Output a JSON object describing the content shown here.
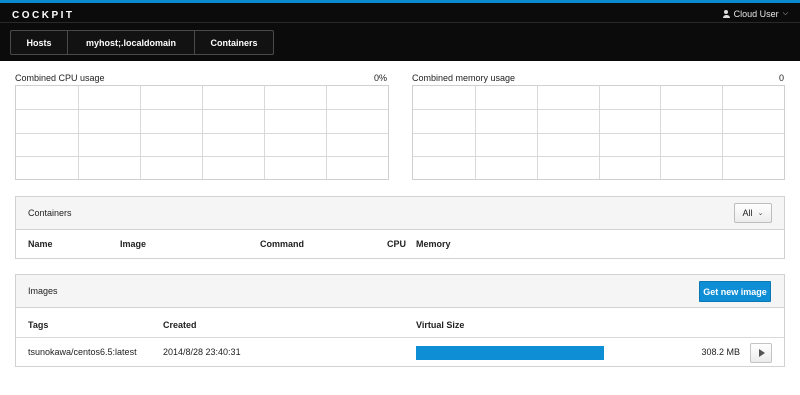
{
  "app": {
    "brand": "COCKPIT",
    "user_label": "Cloud User"
  },
  "breadcrumb": [
    "Hosts",
    "myhost;.localdomain",
    "Containers"
  ],
  "cpu_chart": {
    "title": "Combined CPU usage",
    "value": "0%"
  },
  "memory_chart": {
    "title": "Combined memory usage",
    "value": "0"
  },
  "containers": {
    "title": "Containers",
    "filter": "All",
    "columns": [
      "Name",
      "Image",
      "Command",
      "CPU",
      "Memory"
    ]
  },
  "images": {
    "title": "Images",
    "get_button": "Get new image",
    "columns": [
      "Tags",
      "Created",
      "Virtual Size"
    ],
    "rows": [
      {
        "tag": "tsunokawa/centos6.5:latest",
        "created": "2014/8/28 23:40:31",
        "size": "308.2 MB",
        "size_fraction": 1.0
      }
    ]
  },
  "colors": {
    "accent": "#0d8ed5",
    "topbar": "#0b0b0b"
  },
  "icons": {
    "user": "user-icon",
    "caret": "chevron-down-icon",
    "play": "play-icon"
  }
}
